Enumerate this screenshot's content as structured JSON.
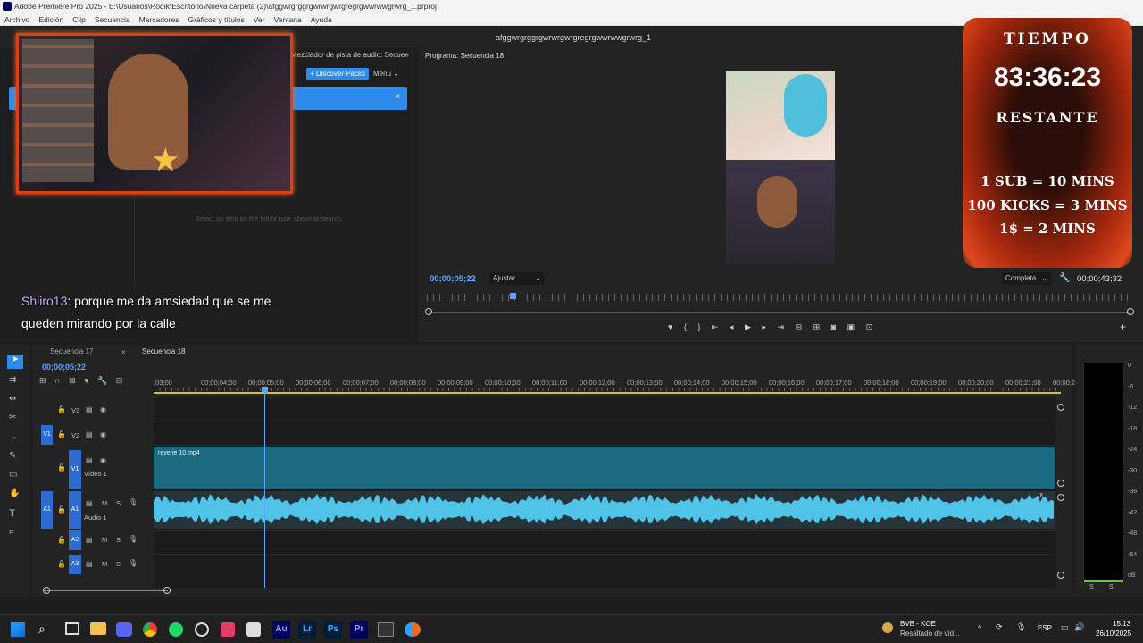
{
  "window": {
    "title": "Adobe Premiere Pro 2025 - E:\\Usuarios\\Rodik\\Escritorio\\Nueva carpeta (2)\\afggwrgrggrgwrwrgwrgregrgwwrwwgrwrg_1.prproj",
    "doc_title": "afggwrgrggrgwrwrgwrgregrgwwrwwgrwrg_1"
  },
  "menu": [
    "Archivo",
    "Edición",
    "Clip",
    "Secuencia",
    "Marcadores",
    "Gráficos y títulos",
    "Ver",
    "Ventana",
    "Ayuda"
  ],
  "left_panel": {
    "tab": "Mezclador de pista de audio: Secuencia",
    "discover": "+ Discover Packs",
    "menu": "Menu",
    "empty_hint": "Select an item on the left or type above to search."
  },
  "chat": {
    "user": "Shiiro13",
    "message": ": porque me da amsiedad que se me queden mirando por la calle"
  },
  "program": {
    "title": "Programa: Secuencia 18",
    "timecode": "00;00;05;22",
    "fit": "Ajustar",
    "quality": "Completa",
    "duration": "00;00;43;32"
  },
  "overlay": {
    "l1": "TIEMPO",
    "timer": "83:36:23",
    "l2": "RESTANTE",
    "r1": "1 SUB = 10 MINS",
    "r2": "100 KICKS = 3 MINS",
    "r3": "1$ = 2 MINS"
  },
  "timeline": {
    "tabs": [
      "Secuencia 17",
      "Secuencia 18"
    ],
    "timecode": "00;00;05;22",
    "ruler": [
      ";03;00",
      "00;00;04;00",
      "00;00;05;00",
      "00;00;06;00",
      "00;00;07;00",
      "00;00;08;00",
      "00;00;09;00",
      "00;00;10;00",
      "00;00;11;00",
      "00;00;12;00",
      "00;00;13;00",
      "00;00;14;00",
      "00;00;15;00",
      "00;00;16;00",
      "00;00;17;00",
      "00;00;18;00",
      "00;00;19;00",
      "00;00;20;00",
      "00;00;21;00",
      "00;00;2"
    ],
    "tracks": {
      "v3": "V3",
      "v2": "V2",
      "v1": "V1",
      "video1": "Vídeo 1",
      "a1": "A1",
      "audio1": "Audio 1",
      "a2": "A2",
      "a3": "A3",
      "m": "M",
      "s": "S"
    },
    "clip": "reverie 10.mp4"
  },
  "meter": {
    "scale": [
      "0",
      "-6",
      "-12",
      "-18",
      "-24",
      "-30",
      "-36",
      "-42",
      "-48",
      "-54",
      "dB"
    ],
    "bottom": [
      "S",
      "S"
    ]
  },
  "taskbar": {
    "media_title": "BVB - KOE",
    "media_sub": "Resaltado de víd...",
    "lang": "ESP",
    "time": "15:13",
    "date": "26/10/2025",
    "apps": [
      "Au",
      "Lr",
      "Ps",
      "Pr"
    ]
  },
  "colors": {
    "accent": "#2d8ceb",
    "clip": "#1b6a7f",
    "audio": "#4fc3e8",
    "timer_fire": "#e0481e"
  }
}
